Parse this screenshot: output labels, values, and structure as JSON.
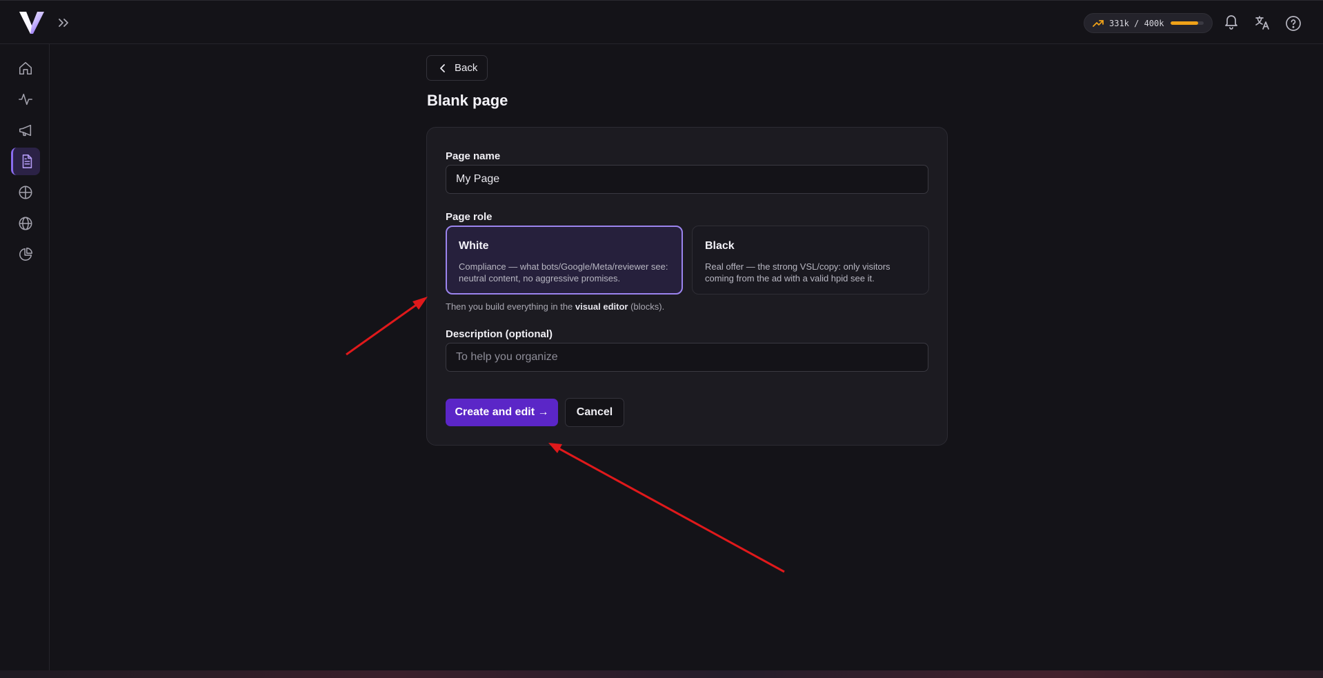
{
  "header": {
    "usage_text": "331k / 400k",
    "usage_fraction": 0.83,
    "usage_color": "#f0a218",
    "icons": [
      "logo-icon",
      "expand-icon",
      "trend-up-icon",
      "bell-icon",
      "translate-icon",
      "help-icon"
    ]
  },
  "sidebar": {
    "items": [
      {
        "icon": "home-icon"
      },
      {
        "icon": "activity-icon"
      },
      {
        "icon": "megaphone-icon"
      },
      {
        "icon": "document-icon",
        "active": true
      },
      {
        "icon": "crosshair-icon"
      },
      {
        "icon": "globe-icon"
      },
      {
        "icon": "pie-chart-icon"
      }
    ],
    "accent_color": "#8a6cf0"
  },
  "main": {
    "back_label": "Back",
    "title": "Blank page",
    "form": {
      "name_label": "Page name",
      "name_value": "My Page",
      "role_label": "Page role",
      "roles": [
        {
          "title": "White",
          "description": "Compliance — what bots/Google/Meta/reviewer see: neutral content, no aggressive promises.",
          "selected": true
        },
        {
          "title": "Black",
          "description": "Real offer — the strong VSL/copy: only visitors coming from the ad with a valid hpid see it.",
          "selected": false
        }
      ],
      "hint_prefix": "Then you build everything in the ",
      "hint_bold": "visual editor",
      "hint_suffix": " (blocks).",
      "description_label": "Description (optional)",
      "description_placeholder": "To help you organize",
      "create_label": "Create and edit →",
      "cancel_label": "Cancel"
    },
    "primary_color": "#5b26c7"
  },
  "annotations": {
    "arrow_color": "#e0191b"
  }
}
